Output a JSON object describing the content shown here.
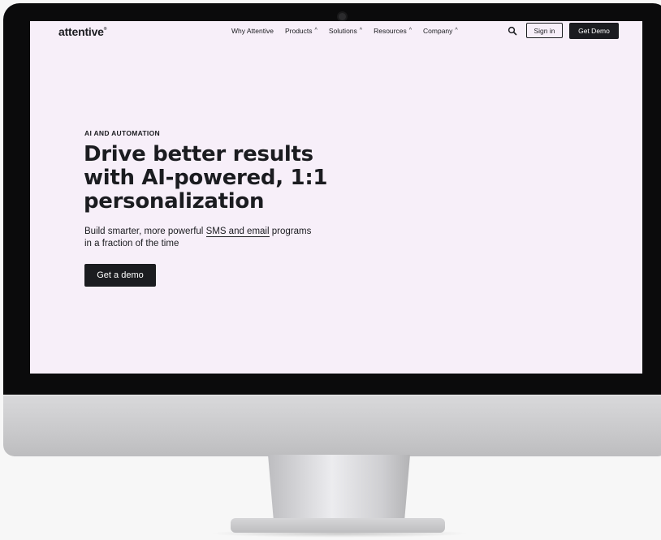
{
  "nav": {
    "logo": "attentive",
    "links": [
      {
        "label": "Why Attentive",
        "chevron": false
      },
      {
        "label": "Products",
        "chevron": true
      },
      {
        "label": "Solutions",
        "chevron": true
      },
      {
        "label": "Resources",
        "chevron": true
      },
      {
        "label": "Company",
        "chevron": true
      }
    ],
    "search_icon": "search-icon",
    "sign_in": "Sign in",
    "get_demo": "Get Demo"
  },
  "hero": {
    "eyebrow": "AI AND AUTOMATION",
    "headline": "Drive better results with AI-powered, 1:1 personalization",
    "subtitle_pre": "Build smarter, more powerful ",
    "subtitle_link": "SMS and email",
    "subtitle_post": " programs in a fraction of the time",
    "cta": "Get a demo"
  },
  "colors": {
    "page_bg": "#f7eff9",
    "text": "#1b1c20",
    "button_bg": "#1b1c20"
  }
}
